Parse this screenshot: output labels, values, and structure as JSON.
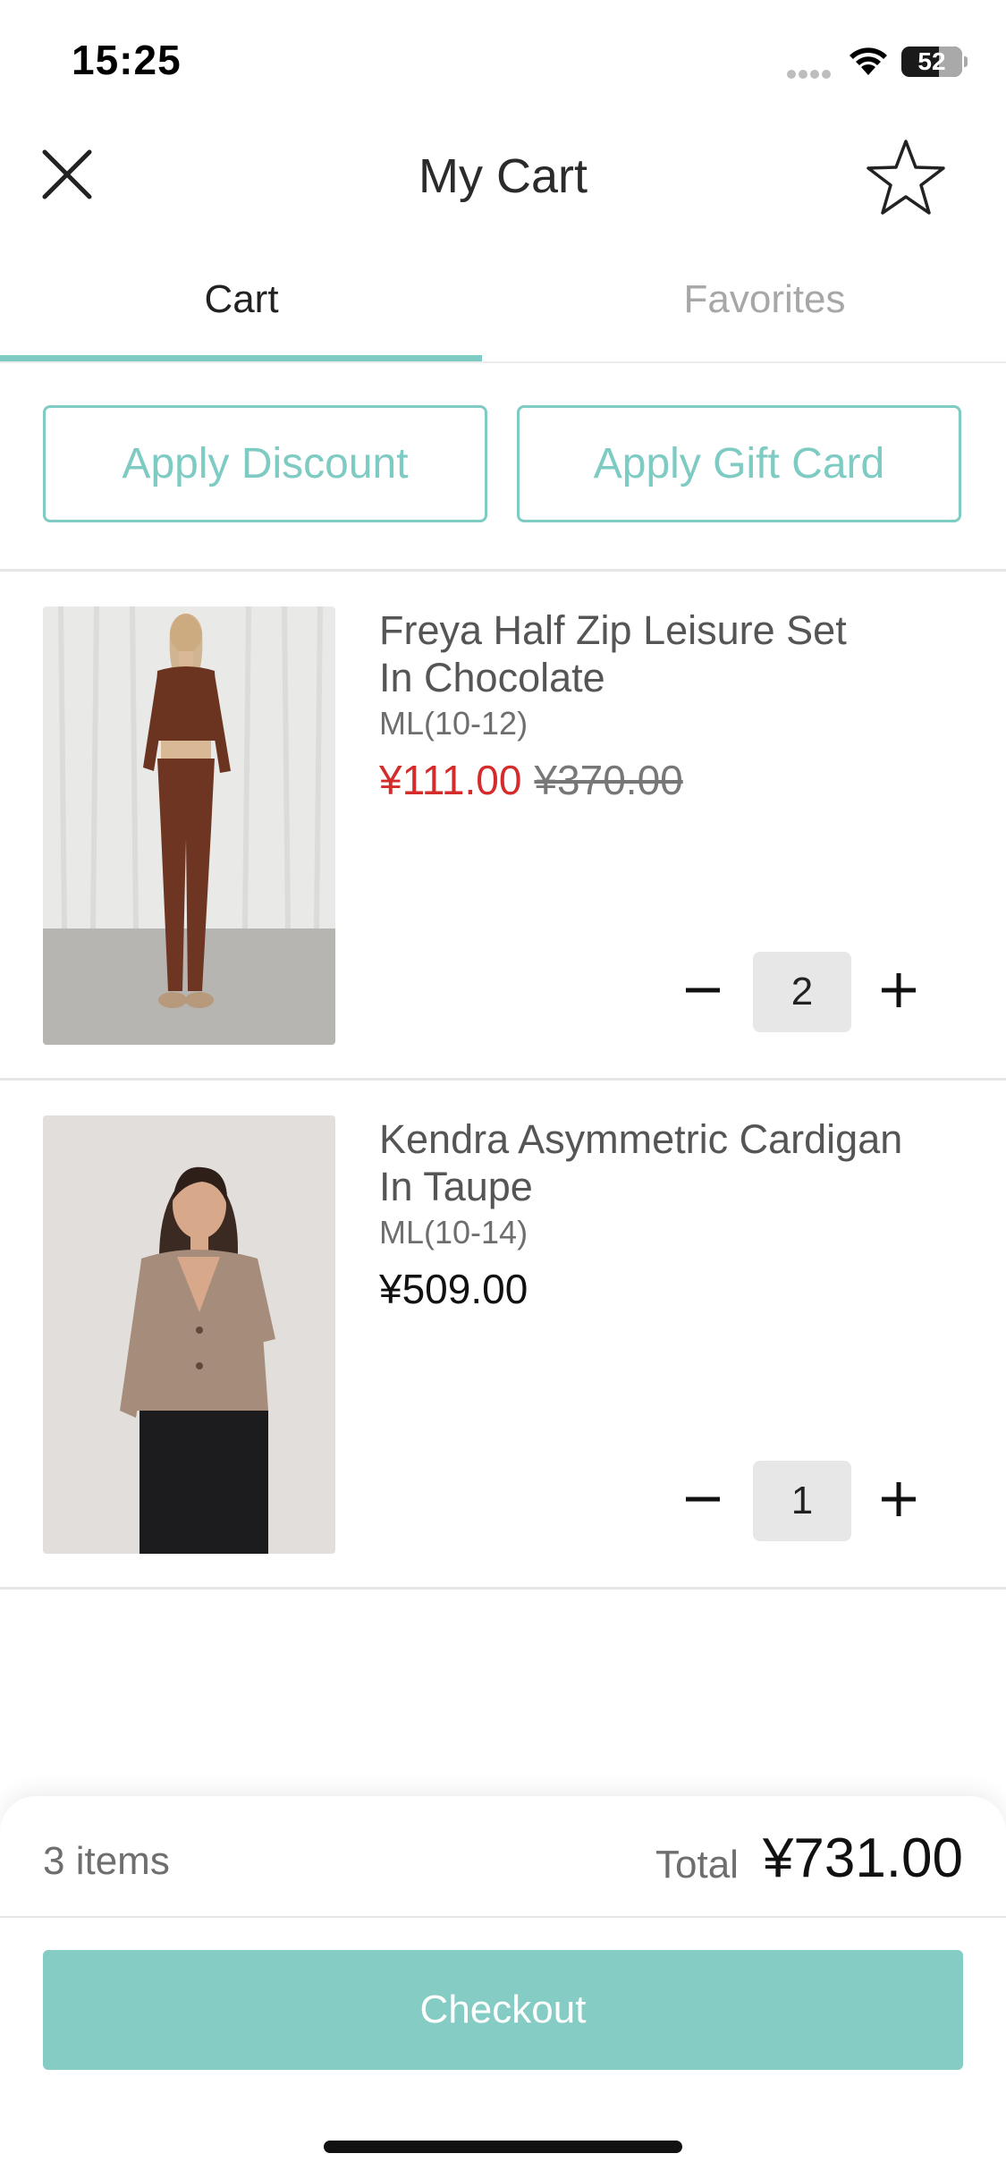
{
  "status_bar": {
    "time": "15:25",
    "battery": "52"
  },
  "header": {
    "title": "My Cart"
  },
  "tabs": [
    {
      "label": "Cart",
      "active": true
    },
    {
      "label": "Favorites",
      "active": false
    }
  ],
  "actions": {
    "discount_label": "Apply Discount",
    "gift_card_label": "Apply Gift Card"
  },
  "items": [
    {
      "name_line1": "Freya Half Zip Leisure Set",
      "name_line2": "In Chocolate",
      "size": "ML(10-12)",
      "sale_price": "¥111.00",
      "original_price": "¥370.00",
      "quantity": "2"
    },
    {
      "name_line1": "Kendra Asymmetric Cardigan",
      "name_line2": "In Taupe",
      "size": "ML(10-14)",
      "price": "¥509.00",
      "quantity": "1"
    }
  ],
  "summary": {
    "items_count": "3 items",
    "total_label": "Total",
    "total_value": "¥731.00",
    "checkout_label": "Checkout"
  },
  "colors": {
    "accent": "#7ecbc3",
    "checkout": "#84ccc4",
    "sale": "#d42b2b"
  }
}
